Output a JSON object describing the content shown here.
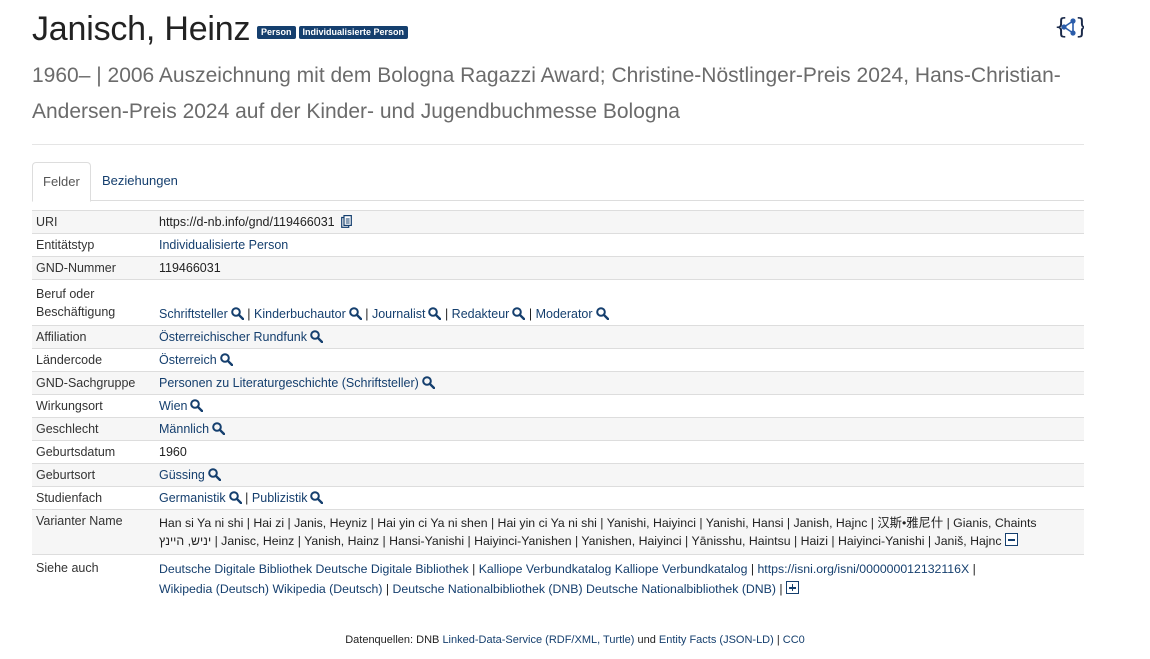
{
  "header": {
    "name": "Janisch, Heinz",
    "badges": [
      "Person",
      "Individualisierte Person"
    ],
    "subtitle": "1960– | 2006 Auszeichnung mit dem Bologna Ragazzi Award; Christine-Nöstlinger-Preis 2024, Hans-Christian-Andersen-Preis 2024 auf der Kinder- und Jugendbuchmesse Bologna",
    "logo_icon": "json-ld-graph-icon"
  },
  "tabs": [
    {
      "label": "Felder",
      "active": true
    },
    {
      "label": "Beziehungen",
      "active": false
    }
  ],
  "fields": {
    "uri": {
      "label": "URI",
      "value": "https://d-nb.info/gnd/119466031"
    },
    "entity": {
      "label": "Entitätstyp",
      "value": "Individualisierte Person"
    },
    "gnd": {
      "label": "GND-Nummer",
      "value": "119466031"
    },
    "beruf": {
      "label_1": "Beruf oder",
      "label_2": "Beschäftigung",
      "items": [
        "Schriftsteller",
        "Kinderbuchautor",
        "Journalist",
        "Redakteur",
        "Moderator"
      ]
    },
    "affiliation": {
      "label": "Affiliation",
      "value": "Österreichischer Rundfunk"
    },
    "laender": {
      "label": "Ländercode",
      "value": "Österreich"
    },
    "sachgruppe": {
      "label": "GND-Sachgruppe",
      "value": "Personen zu Literaturgeschichte (Schriftsteller)"
    },
    "wirkungsort": {
      "label": "Wirkungsort",
      "value": "Wien"
    },
    "geschlecht": {
      "label": "Geschlecht",
      "value": "Männlich"
    },
    "geburtsdatum": {
      "label": "Geburtsdatum",
      "value": "1960"
    },
    "geburtsort": {
      "label": "Geburtsort",
      "value": "Güssing"
    },
    "studienfach": {
      "label": "Studienfach",
      "items": [
        "Germanistik",
        "Publizistik"
      ]
    },
    "variant": {
      "label": "Varianter Name",
      "line1": "Han si Ya ni shi | Hai zi | Janis, Heyniz | Hai yin ci Ya ni shen | Hai yin ci Ya ni shi | Yanishi, Haiyinci | Yanishi, Hansi | Janish, Hajnc | 汉斯•雅尼什 | Gianis, Chaints",
      "line2": "יניש, היינץ | Janisc, Heinz | Yanish, Hainz | Hansi-Yanishi | Haiyinci-Yanishen | Yanishen, Haiyinci | Yānisshu, Haintsu | Haizi | Haiyinci-Yanishi | Janiš, Hajnc"
    },
    "siehe": {
      "label": "Siehe auch",
      "dde_a": "Deutsche Digitale Bibliothek",
      "dde_b": "Deutsche Digitale Bibliothek",
      "kal_a": "Kalliope Verbundkatalog",
      "kal_b": "Kalliope Verbundkatalog",
      "isni": "https://isni.org/isni/000000012132116X",
      "wiki_a": "Wikipedia (Deutsch)",
      "wiki_b": "Wikipedia (Deutsch)",
      "dnb_a": "Deutsche Nationalbibliothek (DNB)",
      "dnb_b": "Deutsche Nationalbibliothek (DNB)"
    }
  },
  "footer": {
    "prefix": "Datenquellen: DNB",
    "lds": "Linked-Data-Service",
    "rdf": "(RDF/XML,",
    "turtle": "Turtle)",
    "und": "und",
    "ef": "Entity Facts",
    "jsonld": "(JSON-LD)",
    "sep": "|",
    "cc0": "CC0"
  }
}
